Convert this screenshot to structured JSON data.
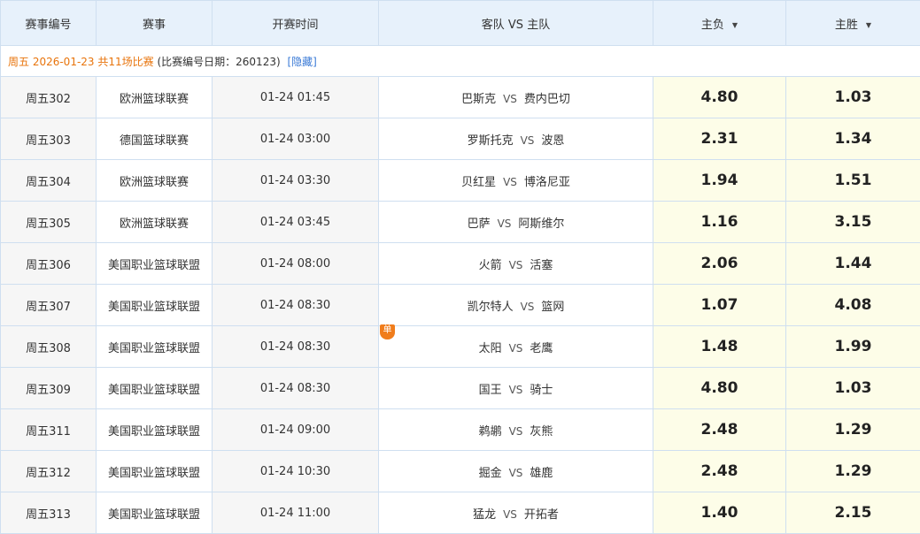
{
  "header": {
    "col_id": "赛事编号",
    "col_league": "赛事",
    "col_time": "开赛时间",
    "col_teams": "客队 VS 主队",
    "col_away_odds": "主负",
    "col_home_odds": "主胜",
    "sort_glyph": "▼"
  },
  "day": {
    "date_text": "周五 2026-01-23 共11场比赛",
    "info_text": "(比赛编号日期：260123)",
    "hide_label": "[隐藏]"
  },
  "vs_label": "VS",
  "single_badge": "单",
  "matches": [
    {
      "id": "周五302",
      "league": "欧洲篮球联赛",
      "time": "01-24 01:45",
      "away": "巴斯克",
      "home": "费内巴切",
      "odds_away": "4.80",
      "odds_home": "1.03"
    },
    {
      "id": "周五303",
      "league": "德国篮球联赛",
      "time": "01-24 03:00",
      "away": "罗斯托克",
      "home": "波恩",
      "odds_away": "2.31",
      "odds_home": "1.34"
    },
    {
      "id": "周五304",
      "league": "欧洲篮球联赛",
      "time": "01-24 03:30",
      "away": "贝红星",
      "home": "博洛尼亚",
      "odds_away": "1.94",
      "odds_home": "1.51"
    },
    {
      "id": "周五305",
      "league": "欧洲篮球联赛",
      "time": "01-24 03:45",
      "away": "巴萨",
      "home": "阿斯维尔",
      "odds_away": "1.16",
      "odds_home": "3.15"
    },
    {
      "id": "周五306",
      "league": "美国职业篮球联盟",
      "time": "01-24 08:00",
      "away": "火箭",
      "home": "活塞",
      "odds_away": "2.06",
      "odds_home": "1.44"
    },
    {
      "id": "周五307",
      "league": "美国职业篮球联盟",
      "time": "01-24 08:30",
      "away": "凯尔特人",
      "home": "篮网",
      "odds_away": "1.07",
      "odds_home": "4.08"
    },
    {
      "id": "周五308",
      "league": "美国职业篮球联盟",
      "time": "01-24 08:30",
      "away": "太阳",
      "home": "老鹰",
      "odds_away": "1.48",
      "odds_home": "1.99",
      "single": true
    },
    {
      "id": "周五309",
      "league": "美国职业篮球联盟",
      "time": "01-24 08:30",
      "away": "国王",
      "home": "骑士",
      "odds_away": "4.80",
      "odds_home": "1.03"
    },
    {
      "id": "周五311",
      "league": "美国职业篮球联盟",
      "time": "01-24 09:00",
      "away": "鹈鹕",
      "home": "灰熊",
      "odds_away": "2.48",
      "odds_home": "1.29"
    },
    {
      "id": "周五312",
      "league": "美国职业篮球联盟",
      "time": "01-24 10:30",
      "away": "掘金",
      "home": "雄鹿",
      "odds_away": "2.48",
      "odds_home": "1.29"
    },
    {
      "id": "周五313",
      "league": "美国职业篮球联盟",
      "time": "01-24 11:00",
      "away": "猛龙",
      "home": "开拓者",
      "odds_away": "1.40",
      "odds_home": "2.15"
    }
  ]
}
